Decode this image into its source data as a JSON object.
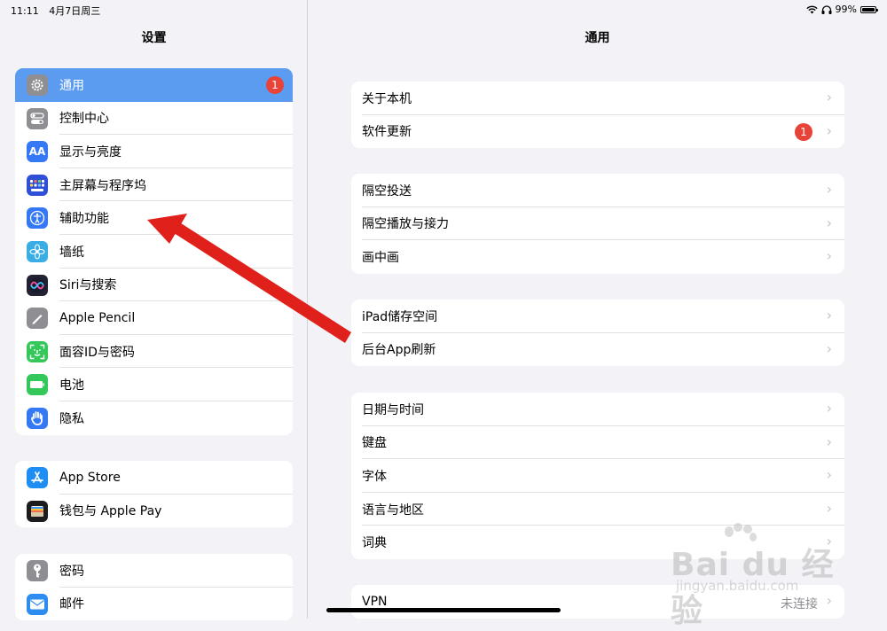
{
  "status": {
    "time": "11:11",
    "date": "4月7日周三",
    "battery": "99%",
    "battery_level": 0.99
  },
  "sidebar": {
    "title": "设置",
    "groups": [
      [
        {
          "label": "通用",
          "icon": "gear-icon",
          "color": "#8e8e93",
          "badge": "1",
          "selected": true
        },
        {
          "label": "控制中心",
          "icon": "toggles-icon",
          "color": "#8e8e93"
        },
        {
          "label": "显示与亮度",
          "icon": "text-size-icon",
          "color": "#3478f6",
          "glyph": "AA"
        },
        {
          "label": "主屏幕与程序坞",
          "icon": "home-grid-icon",
          "color": "#2f4fd6"
        },
        {
          "label": "辅助功能",
          "icon": "accessibility-icon",
          "color": "#3478f6"
        },
        {
          "label": "墙纸",
          "icon": "flower-icon",
          "color": "#38aee5"
        },
        {
          "label": "Siri与搜索",
          "icon": "siri-icon",
          "color": "#222233"
        },
        {
          "label": "Apple Pencil",
          "icon": "pencil-icon",
          "color": "#8e8e93"
        },
        {
          "label": "面容ID与密码",
          "icon": "face-id-icon",
          "color": "#34c759"
        },
        {
          "label": "电池",
          "icon": "battery-icon",
          "color": "#34c759"
        },
        {
          "label": "隐私",
          "icon": "hand-icon",
          "color": "#3478f6"
        }
      ],
      [
        {
          "label": "App Store",
          "icon": "app-store-icon",
          "color": "#1e8ef5"
        },
        {
          "label": "钱包与 Apple Pay",
          "icon": "wallet-icon",
          "color": "#1c1c1e"
        }
      ],
      [
        {
          "label": "密码",
          "icon": "key-icon",
          "color": "#8e8e93"
        },
        {
          "label": "邮件",
          "icon": "mail-icon",
          "color": "#2d8cf0"
        }
      ]
    ]
  },
  "main": {
    "title": "通用",
    "groups": [
      [
        {
          "label": "关于本机"
        },
        {
          "label": "软件更新",
          "badge": "1"
        }
      ],
      [
        {
          "label": "隔空投送"
        },
        {
          "label": "隔空播放与接力"
        },
        {
          "label": "画中画"
        }
      ],
      [
        {
          "label": "iPad储存空间"
        },
        {
          "label": "后台App刷新"
        }
      ],
      [
        {
          "label": "日期与时间"
        },
        {
          "label": "键盘"
        },
        {
          "label": "字体"
        },
        {
          "label": "语言与地区"
        },
        {
          "label": "词典"
        }
      ],
      [
        {
          "label": "VPN",
          "detail": "未连接"
        }
      ]
    ]
  },
  "watermark": {
    "brand": "Bai du 经验",
    "sub": "jingyan.baidu.com"
  },
  "colors": {
    "accent": "#5b9bf0",
    "badge": "#e84339",
    "arrow": "#e0201b"
  }
}
